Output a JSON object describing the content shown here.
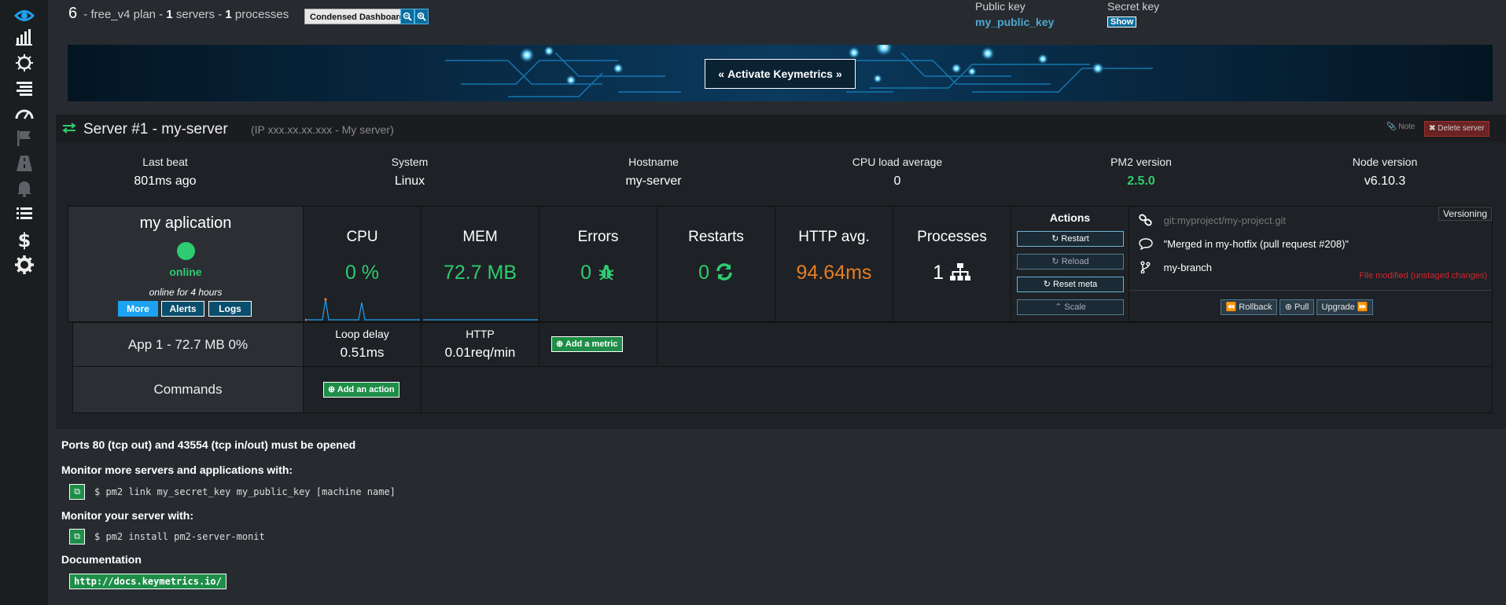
{
  "colors": {
    "accent": "#4ba8cf",
    "green": "#2dcc70",
    "orange": "#e67e22",
    "danger": "#d9232e"
  },
  "sidebar": {
    "items": [
      {
        "icon": "eye-icon",
        "label": "dashboard"
      },
      {
        "icon": "bar-chart-icon",
        "label": "metrics"
      },
      {
        "icon": "bug-icon",
        "label": "issues"
      },
      {
        "icon": "list-icon",
        "label": "logs"
      },
      {
        "icon": "speedometer-icon",
        "label": "monitoring"
      },
      {
        "icon": "flag-icon",
        "label": "deployments"
      },
      {
        "icon": "road-icon",
        "label": "transactions"
      },
      {
        "icon": "bell-icon",
        "label": "notifications"
      },
      {
        "icon": "list-bullets-icon",
        "label": "events"
      },
      {
        "icon": "dollar-icon",
        "label": "billing"
      },
      {
        "icon": "gear-icon",
        "label": "settings"
      }
    ]
  },
  "topbar": {
    "count": "6",
    "plan_text": "- free_v4 plan -",
    "servers_count": "1",
    "servers_label": "servers -",
    "processes_count": "1",
    "processes_label": "processes",
    "condensed_label": "Condensed Dashboard",
    "public_key_label": "Public key",
    "public_key_value": "my_public_key",
    "secret_key_label": "Secret key",
    "show_label": "Show"
  },
  "banner": {
    "activate_label": "Activate Keymetrics"
  },
  "server": {
    "title": "Server #1 - my-server",
    "subtitle": "(IP xxx.xx.xx.xxx - My server)",
    "note_label": "Note",
    "delete_label": "Delete server",
    "info": [
      {
        "label": "Last beat",
        "value": "801ms ago"
      },
      {
        "label": "System",
        "value": "Linux"
      },
      {
        "label": "Hostname",
        "value": "my-server"
      },
      {
        "label": "CPU load average",
        "value": "0"
      },
      {
        "label": "PM2 version",
        "value": "2.5.0"
      },
      {
        "label": "Node version",
        "value": "v6.10.3"
      }
    ]
  },
  "app": {
    "name": "my aplication",
    "status": "online",
    "online_for": "online for 4 hours",
    "more_label": "More",
    "alerts_label": "Alerts",
    "logs_label": "Logs"
  },
  "metrics": {
    "cpu": {
      "label": "CPU",
      "value": "0 %"
    },
    "mem": {
      "label": "MEM",
      "value": "72.7 MB"
    },
    "errors": {
      "label": "Errors",
      "value": "0"
    },
    "restarts": {
      "label": "Restarts",
      "value": "0"
    },
    "http": {
      "label": "HTTP avg.",
      "value": "94.64ms"
    },
    "processes": {
      "label": "Processes",
      "value": "1"
    }
  },
  "actions": {
    "header": "Actions",
    "restart": "Restart",
    "reload": "Reload",
    "reset_meta": "Reset meta",
    "scale": "Scale"
  },
  "versioning": {
    "tag": "Versioning",
    "repo": "git:myproject/my-project.git",
    "commit": "\"Merged in my-hotfix (pull request #208)\"",
    "branch": "my-branch",
    "modified": "File modified (unstaged changes)",
    "rollback": "Rollback",
    "pull": "Pull",
    "upgrade": "Upgrade"
  },
  "process_row": {
    "label": "App 1 - 72.7 MB 0%",
    "loop_delay_label": "Loop delay",
    "loop_delay_value": "0.51ms",
    "http_label": "HTTP",
    "http_value": "0.01req/min",
    "add_metric": "Add a metric"
  },
  "commands_row": {
    "label": "Commands",
    "add_action": "Add an action"
  },
  "bottom": {
    "ports": "Ports 80 (tcp out) and 43554 (tcp in/out) must be opened",
    "monitor_more": "Monitor more servers and applications with:",
    "link_cmd": "$ pm2 link my_secret_key my_public_key [machine name]",
    "monitor_server": "Monitor your server with:",
    "install_cmd": "$ pm2 install pm2-server-monit",
    "docs_label": "Documentation",
    "docs_url": "http://docs.keymetrics.io/"
  }
}
